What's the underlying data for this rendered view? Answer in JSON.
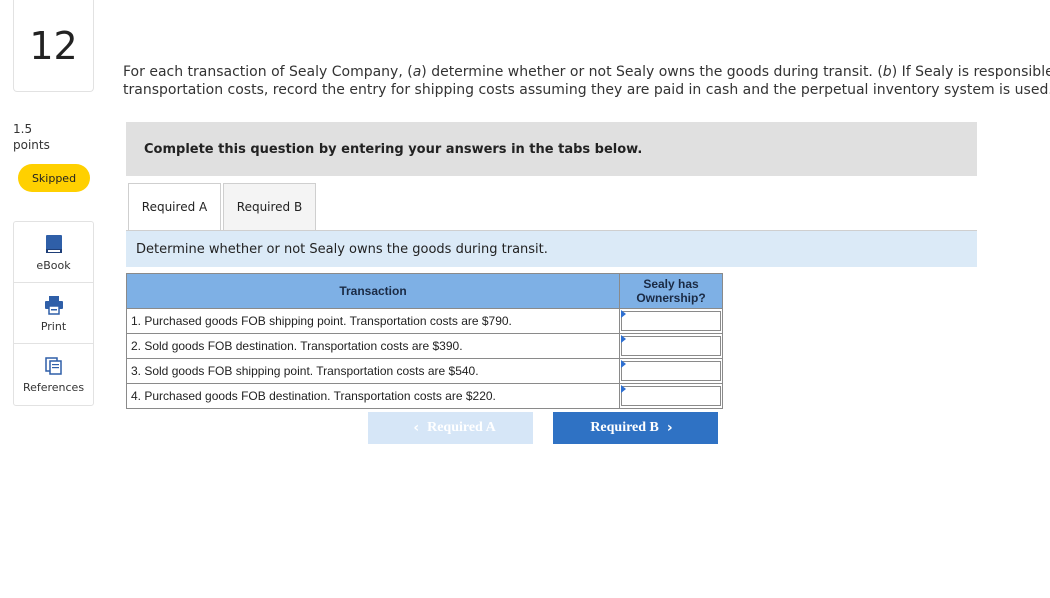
{
  "question": {
    "number": "12",
    "points_value": "1.5",
    "points_label": "points",
    "status": "Skipped"
  },
  "tools": [
    {
      "label": "eBook",
      "icon": "book-icon"
    },
    {
      "label": "Print",
      "icon": "printer-icon"
    },
    {
      "label": "References",
      "icon": "references-icon"
    }
  ],
  "instructions": {
    "part1": "For each transaction of Sealy Company, (",
    "a": "a",
    "part2": ") determine whether or not Sealy owns the goods during transit. (",
    "b": "b",
    "part3": ") If Sealy is responsible fo",
    "line2": "transportation costs, record the entry for shipping costs assuming they are paid in cash and the perpetual inventory system is used."
  },
  "banner": "Complete this question by entering your answers in the tabs below.",
  "tabs": [
    {
      "label": "Required A",
      "active": true
    },
    {
      "label": "Required B",
      "active": false
    }
  ],
  "prompt": "Determine whether or not Sealy owns the goods during transit.",
  "table": {
    "headers": {
      "transaction": "Transaction",
      "ownership_line1": "Sealy has",
      "ownership_line2": "Ownership?"
    },
    "rows": [
      {
        "transaction": "1. Purchased goods FOB shipping point. Transportation costs are $790.",
        "answer": ""
      },
      {
        "transaction": "2. Sold goods FOB destination. Transportation costs are $390.",
        "answer": ""
      },
      {
        "transaction": "3. Sold goods FOB shipping point. Transportation costs are $540.",
        "answer": ""
      },
      {
        "transaction": "4. Purchased goods FOB destination. Transportation costs are $220.",
        "answer": ""
      }
    ]
  },
  "nav": {
    "prev_label": "Required A",
    "next_label": "Required B",
    "prev_icon": "chevron-left-icon",
    "next_icon": "chevron-right-icon"
  },
  "colors": {
    "skipped_badge": "#ffd000",
    "table_header": "#7eb0e5",
    "prompt_bg": "#dbeaf7",
    "next_button": "#2f72c4",
    "prev_button_disabled": "#d6e6f7"
  }
}
